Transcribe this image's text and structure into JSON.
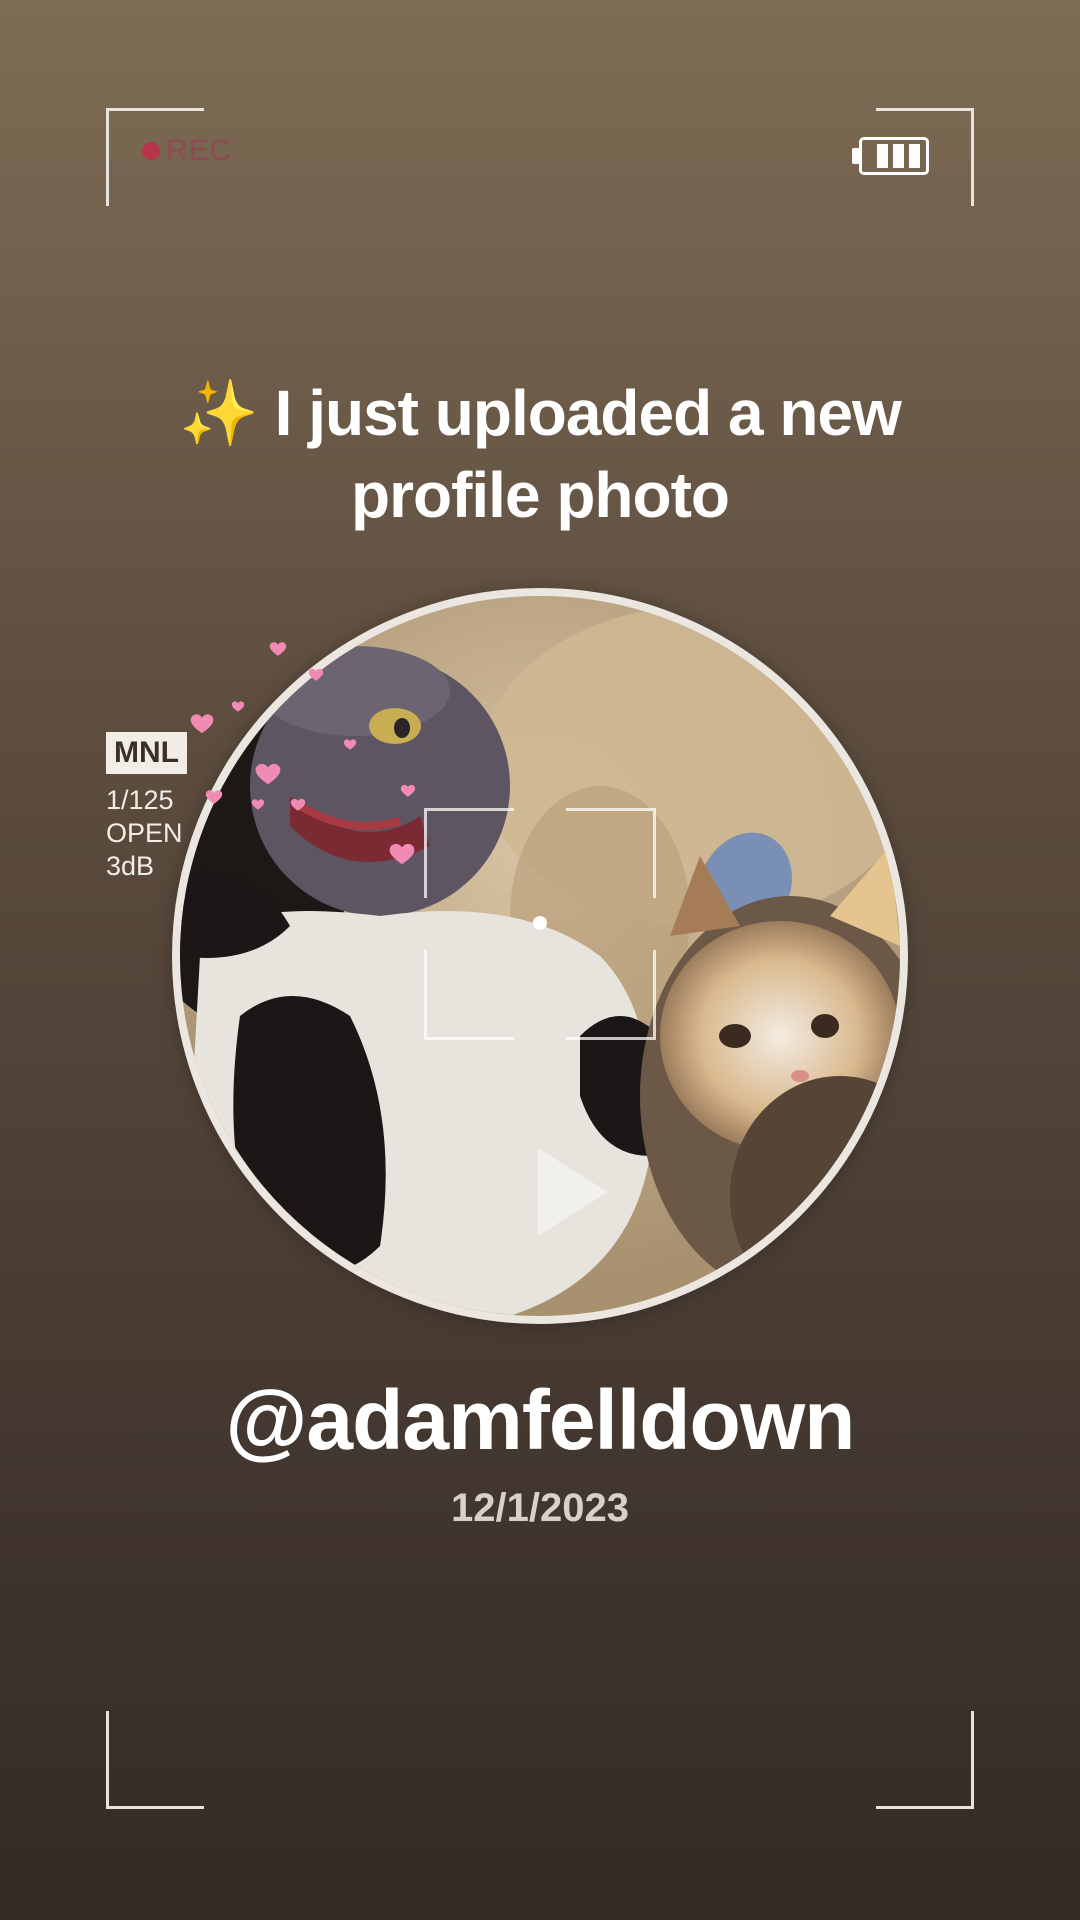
{
  "overlay": {
    "rec_label": "REC",
    "battery_icon": "battery-icon",
    "battery_bars": 3
  },
  "headline": {
    "emoji": "✨",
    "text": "I just uploaded a new profile photo"
  },
  "camera": {
    "mode": "MNL",
    "shutter": "1/125",
    "aperture": "OPEN",
    "gain": "3dB"
  },
  "profile": {
    "username": "@adamfelldown",
    "date": "12/1/2023"
  },
  "icons": {
    "play": "play-icon",
    "hearts": "heart-icon",
    "sparkles": "sparkles-icon"
  },
  "colors": {
    "background_top": "#7e6c55",
    "background_bottom": "#342a26",
    "rec_red": "#b5354a",
    "heart_pink": "#f28bb4"
  }
}
